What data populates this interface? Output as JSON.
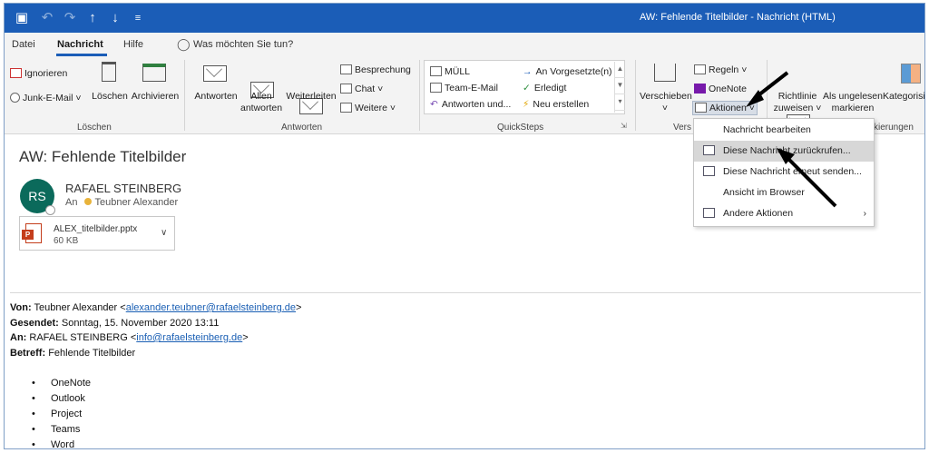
{
  "window": {
    "title": "AW: Fehlende Titelbilder  -  Nachricht (HTML)"
  },
  "menu": {
    "tabs": [
      "Datei",
      "Nachricht",
      "Hilfe"
    ],
    "active": "Nachricht",
    "tell_me": "Was möchten Sie tun?"
  },
  "ribbon": {
    "loeschen": {
      "label": "Löschen",
      "ignorieren": "Ignorieren",
      "junk": "Junk-E-Mail",
      "loeschen_btn": "Löschen",
      "archivieren": "Archivieren"
    },
    "antworten": {
      "label": "Antworten",
      "antworten_btn": "Antworten",
      "allen_line1": "Allen",
      "allen_line2": "antworten",
      "weiterleiten": "Weiterleiten",
      "besprechung": "Besprechung",
      "chat": "Chat",
      "weitere": "Weitere"
    },
    "quicksteps": {
      "label": "QuickSteps",
      "items": [
        "MÜLL",
        "An Vorgesetzte(n)",
        "Team-E-Mail",
        "Erledigt",
        "Antworten und...",
        "Neu erstellen"
      ]
    },
    "verschieben": {
      "label_partial": "Vers",
      "verschieben_btn": "Verschieben",
      "regeln": "Regeln",
      "onenote": "OneNote",
      "aktionen": "Aktionen"
    },
    "richtlinie": {
      "line1": "Richtlinie",
      "line2": "zuweisen"
    },
    "markierungen": {
      "label_partial": "kierungen",
      "ungelesen_line1": "Als ungelesen",
      "ungelesen_line2": "markieren",
      "kategorisieren": "Kategorisi"
    }
  },
  "message": {
    "subject": "AW: Fehlende Titelbilder",
    "avatar_initials": "RS",
    "sender": "RAFAEL STEINBERG",
    "to_label": "An",
    "to_name": "Teubner Alexander",
    "attachment": {
      "name": "ALEX_titelbilder.pptx",
      "size": "60 KB",
      "type_letter": "P"
    },
    "quoted": {
      "von_label": "Von:",
      "von_name": "Teubner Alexander <",
      "von_email": "alexander.teubner@rafaelsteinberg.de",
      "von_end": ">",
      "gesendet_label": "Gesendet:",
      "gesendet_value": "Sonntag, 15. November 2020 13:11",
      "an_label": "An:",
      "an_name": "RAFAEL STEINBERG <",
      "an_email": "info@rafaelsteinberg.de",
      "an_end": ">",
      "betreff_label": "Betreff:",
      "betreff_value": "Fehlende Titelbilder"
    },
    "list": [
      "OneNote",
      "Outlook",
      "Project",
      "Teams",
      "Word"
    ]
  },
  "dropdown": {
    "items": [
      {
        "label": "Nachricht bearbeiten",
        "icon": "none"
      },
      {
        "label": "Diese Nachricht zurückrufen...",
        "icon": "recall-icon"
      },
      {
        "label": "Diese Nachricht erneut senden...",
        "icon": "resend-icon"
      },
      {
        "label": "Ansicht im Browser",
        "icon": "none"
      },
      {
        "label": "Andere Aktionen",
        "icon": "other-actions-icon"
      }
    ],
    "highlighted_index": 1
  },
  "colors": {
    "titlebar": "#1b5db7",
    "avatar": "#0b6a5b",
    "link": "#1a5fb4",
    "highlight": "#d7d7d7"
  }
}
